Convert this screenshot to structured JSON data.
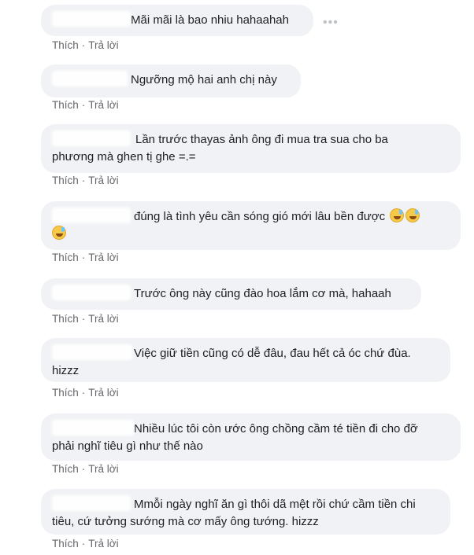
{
  "actions": {
    "like": "Thích",
    "reply": "Trả lời",
    "separator": "·"
  },
  "more_icon": "more-horizontal-icon",
  "comments": [
    {
      "lines": [
        "Mãi mãi là bao nhiu hahaahah"
      ]
    },
    {
      "lines": [
        "Ngưỡng mộ hai anh chị này"
      ]
    },
    {
      "lines": [
        "Lần trước thayas ảnh ông đi mua tra sua cho ba",
        "phương mà ghen tị ghe =.="
      ]
    },
    {
      "lines": [
        "đúng là tình yêu cần sóng gió mới lâu bền được",
        ""
      ],
      "emoji": "grinning-sweat-emoji"
    },
    {
      "lines": [
        "Trước ông này cũng đào hoa lắm cơ mà, hahaah"
      ]
    },
    {
      "lines": [
        "Việc giữ tiền cũng có dễ đâu, đau hết cả óc chứ đùa.",
        "hizzz"
      ]
    },
    {
      "lines": [
        "Nhiều lúc tôi còn ước ông chồng cầm té tiền đi cho đỡ",
        "phải nghĩ tiêu gì như thế nào"
      ]
    },
    {
      "lines": [
        "Mmỗi ngày nghĩ ăn gì thôi dã mệt rồi chứ cầm tiền chi",
        "tiêu, cứ tưởng sướng mà cơ mấy ông tướng. hizzz"
      ]
    }
  ]
}
